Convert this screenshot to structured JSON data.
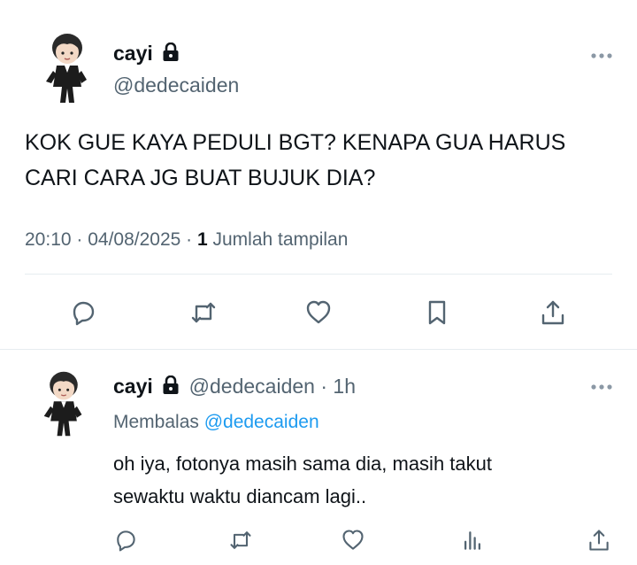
{
  "main_tweet": {
    "display_name": "cayi",
    "handle": "@dedecaiden",
    "text_line1": "KOK GUE KAYA PEDULI BGT? KENAPA GUA HARUS",
    "text_line2": "CARI CARA JG BUAT BUJUK DIA?",
    "timestamp": "20:10 · 04/08/2025 · ",
    "view_count": "1",
    "view_label": " Jumlah tampilan",
    "actions": [
      "reply-icon",
      "retweet-icon",
      "like-icon",
      "bookmark-icon",
      "share-icon"
    ]
  },
  "reply_tweet": {
    "display_name": "cayi",
    "handle_time": "@dedecaiden · 1h",
    "replying_prefix": "Membalas ",
    "replying_to": "@dedecaiden",
    "text_line1": "oh iya, fotonya masih sama dia, masih takut",
    "text_line2": "sewaktu waktu diancam lagi..",
    "actions": [
      "reply-icon",
      "retweet-icon",
      "like-icon",
      "views-icon",
      "share-icon"
    ]
  },
  "colors": {
    "text": "#0f1419",
    "secondary": "#536471",
    "link": "#1d9bf0",
    "divider": "#e6ecf0"
  }
}
